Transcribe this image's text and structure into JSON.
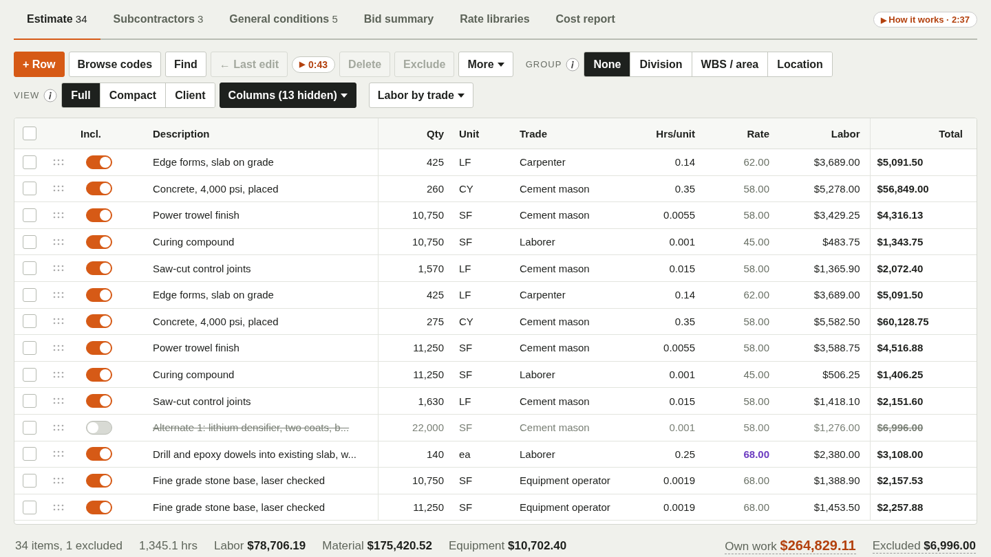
{
  "tabs": [
    {
      "label": "Estimate",
      "count": "34",
      "selected": true
    },
    {
      "label": "Subcontractors",
      "count": "3",
      "selected": false
    },
    {
      "label": "General conditions",
      "count": "5",
      "selected": false
    },
    {
      "label": "Bid summary",
      "selected": false
    },
    {
      "label": "Rate libraries",
      "selected": false
    },
    {
      "label": "Cost report",
      "selected": false
    }
  ],
  "video_link": {
    "icon": "▶",
    "label": "How it works · 2:37"
  },
  "toolbar": {
    "buttons": [
      {
        "kind": "primary",
        "label": "+ Row",
        "disabled": false
      },
      {
        "kind": "plain",
        "label": "Browse codes",
        "disabled": false
      },
      {
        "kind": "plain",
        "label": "Find",
        "disabled": false
      },
      {
        "kind": "plain",
        "label": "← Last edit",
        "disabled": true
      },
      {
        "kind": "play",
        "icon": "▶",
        "label": "0:43",
        "disabled": false
      },
      {
        "kind": "plain",
        "label": "Delete",
        "disabled": true
      },
      {
        "kind": "plain",
        "label": "Exclude",
        "disabled": true
      },
      {
        "kind": "menu",
        "label": "More",
        "disabled": false
      }
    ],
    "group": {
      "label": "GROUP",
      "options": [
        {
          "label": "None",
          "selected": true
        },
        {
          "label": "Division",
          "selected": false
        },
        {
          "label": "WBS / area",
          "selected": false
        },
        {
          "label": "Location",
          "selected": false
        }
      ]
    }
  },
  "view": {
    "label": "VIEW",
    "options": [
      {
        "label": "Full",
        "selected": true
      },
      {
        "label": "Compact",
        "selected": false
      },
      {
        "label": "Client",
        "selected": false
      }
    ],
    "menus": [
      {
        "label": "Columns (13 hidden)",
        "dark": true
      },
      {
        "label": "Labor by trade",
        "dark": false
      }
    ]
  },
  "table": {
    "all_selected": false,
    "columns": [
      "Incl.",
      "Description",
      "Qty",
      "Unit",
      "Trade",
      "Hrs/unit",
      "Rate",
      "Labor",
      "Total"
    ],
    "rows": [
      {
        "selected": false,
        "included": true,
        "description": "Edge forms, slab on grade",
        "qty": "425",
        "unit": "LF",
        "trade": "Carpenter",
        "hrs_unit": "0.14",
        "rate": "62.00",
        "rate_overridden": false,
        "labor": "$3,689.00",
        "total": "$5,091.50"
      },
      {
        "selected": false,
        "included": true,
        "description": "Concrete, 4,000 psi, placed",
        "qty": "260",
        "unit": "CY",
        "trade": "Cement mason",
        "hrs_unit": "0.35",
        "rate": "58.00",
        "rate_overridden": false,
        "labor": "$5,278.00",
        "total": "$56,849.00"
      },
      {
        "selected": false,
        "included": true,
        "description": "Power trowel finish",
        "qty": "10,750",
        "unit": "SF",
        "trade": "Cement mason",
        "hrs_unit": "0.0055",
        "rate": "58.00",
        "rate_overridden": false,
        "labor": "$3,429.25",
        "total": "$4,316.13"
      },
      {
        "selected": false,
        "included": true,
        "description": "Curing compound",
        "qty": "10,750",
        "unit": "SF",
        "trade": "Laborer",
        "hrs_unit": "0.001",
        "rate": "45.00",
        "rate_overridden": false,
        "labor": "$483.75",
        "total": "$1,343.75"
      },
      {
        "selected": false,
        "included": true,
        "description": "Saw-cut control joints",
        "qty": "1,570",
        "unit": "LF",
        "trade": "Cement mason",
        "hrs_unit": "0.015",
        "rate": "58.00",
        "rate_overridden": false,
        "labor": "$1,365.90",
        "total": "$2,072.40"
      },
      {
        "selected": false,
        "included": true,
        "description": "Edge forms, slab on grade",
        "qty": "425",
        "unit": "LF",
        "trade": "Carpenter",
        "hrs_unit": "0.14",
        "rate": "62.00",
        "rate_overridden": false,
        "labor": "$3,689.00",
        "total": "$5,091.50"
      },
      {
        "selected": false,
        "included": true,
        "description": "Concrete, 4,000 psi, placed",
        "qty": "275",
        "unit": "CY",
        "trade": "Cement mason",
        "hrs_unit": "0.35",
        "rate": "58.00",
        "rate_overridden": false,
        "labor": "$5,582.50",
        "total": "$60,128.75"
      },
      {
        "selected": false,
        "included": true,
        "description": "Power trowel finish",
        "qty": "11,250",
        "unit": "SF",
        "trade": "Cement mason",
        "hrs_unit": "0.0055",
        "rate": "58.00",
        "rate_overridden": false,
        "labor": "$3,588.75",
        "total": "$4,516.88"
      },
      {
        "selected": false,
        "included": true,
        "description": "Curing compound",
        "qty": "11,250",
        "unit": "SF",
        "trade": "Laborer",
        "hrs_unit": "0.001",
        "rate": "45.00",
        "rate_overridden": false,
        "labor": "$506.25",
        "total": "$1,406.25"
      },
      {
        "selected": false,
        "included": true,
        "description": "Saw-cut control joints",
        "qty": "1,630",
        "unit": "LF",
        "trade": "Cement mason",
        "hrs_unit": "0.015",
        "rate": "58.00",
        "rate_overridden": false,
        "labor": "$1,418.10",
        "total": "$2,151.60"
      },
      {
        "selected": false,
        "included": false,
        "description": "Alternate 1: lithium densifier, two coats, b...",
        "qty": "22,000",
        "unit": "SF",
        "trade": "Cement mason",
        "hrs_unit": "0.001",
        "rate": "58.00",
        "rate_overridden": false,
        "labor": "$1,276.00",
        "total": "$6,996.00"
      },
      {
        "selected": false,
        "included": true,
        "description": "Drill and epoxy dowels into existing slab, w...",
        "qty": "140",
        "unit": "ea",
        "trade": "Laborer",
        "hrs_unit": "0.25",
        "rate": "68.00",
        "rate_overridden": true,
        "labor": "$2,380.00",
        "total": "$3,108.00"
      },
      {
        "selected": false,
        "included": true,
        "description": "Fine grade stone base, laser checked",
        "qty": "10,750",
        "unit": "SF",
        "trade": "Equipment operator",
        "hrs_unit": "0.0019",
        "rate": "68.00",
        "rate_overridden": false,
        "labor": "$1,388.90",
        "total": "$2,157.53"
      },
      {
        "selected": false,
        "included": true,
        "description": "Fine grade stone base, laser checked",
        "qty": "11,250",
        "unit": "SF",
        "trade": "Equipment operator",
        "hrs_unit": "0.0019",
        "rate": "68.00",
        "rate_overridden": false,
        "labor": "$1,453.50",
        "total": "$2,257.88"
      }
    ]
  },
  "status_bar": [
    {
      "kind": "text",
      "value": "34 items, 1 excluded"
    },
    {
      "kind": "text",
      "value": "1,345.1 hrs"
    },
    {
      "kind": "sum",
      "label": "Labor",
      "value": "$78,706.19"
    },
    {
      "kind": "sum",
      "label": "Material",
      "value": "$175,420.52"
    },
    {
      "kind": "sum",
      "label": "Equipment",
      "value": "$10,702.40"
    },
    {
      "kind": "highlight",
      "label": "Own work",
      "value": "$264,829.11"
    },
    {
      "kind": "underlined",
      "label": "Excluded",
      "value": "$6,996.00"
    }
  ]
}
